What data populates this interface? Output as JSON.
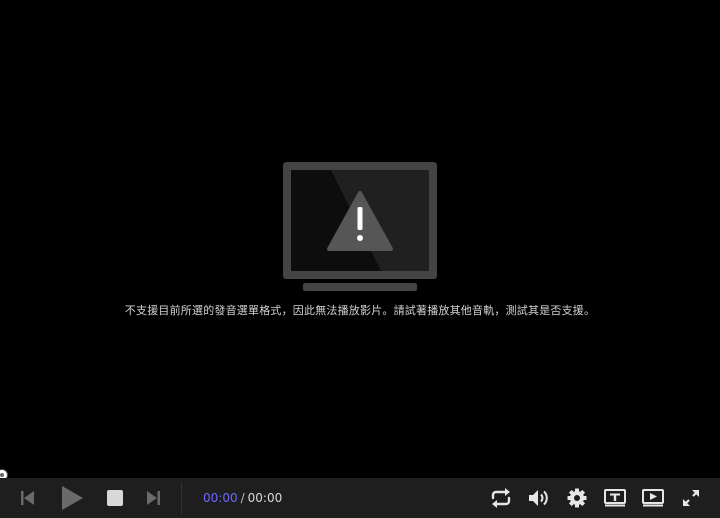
{
  "player": {
    "error_message": "不支援目前所選的發音選單格式，因此無法播放影片。請試著播放其他音軌，測試其是否支援。",
    "error_icon": "tv-warning-icon",
    "time": {
      "current": "00:00",
      "separator": "/",
      "duration": "00:00"
    },
    "controls": {
      "previous": "skip-previous-icon",
      "play": "play-icon",
      "stop": "stop-icon",
      "next": "skip-next-icon",
      "repeat": "repeat-icon",
      "volume": "volume-icon",
      "settings": "gear-icon",
      "subtitles": "subtitle-icon",
      "playback_mode": "playlist-play-icon",
      "fullscreen": "fullscreen-icon"
    },
    "colors": {
      "accent": "#6e68ff",
      "control_bar": "#1e1e1e",
      "icon_dim": "#6a6a6a",
      "icon_bright": "#e6e6e6"
    }
  }
}
